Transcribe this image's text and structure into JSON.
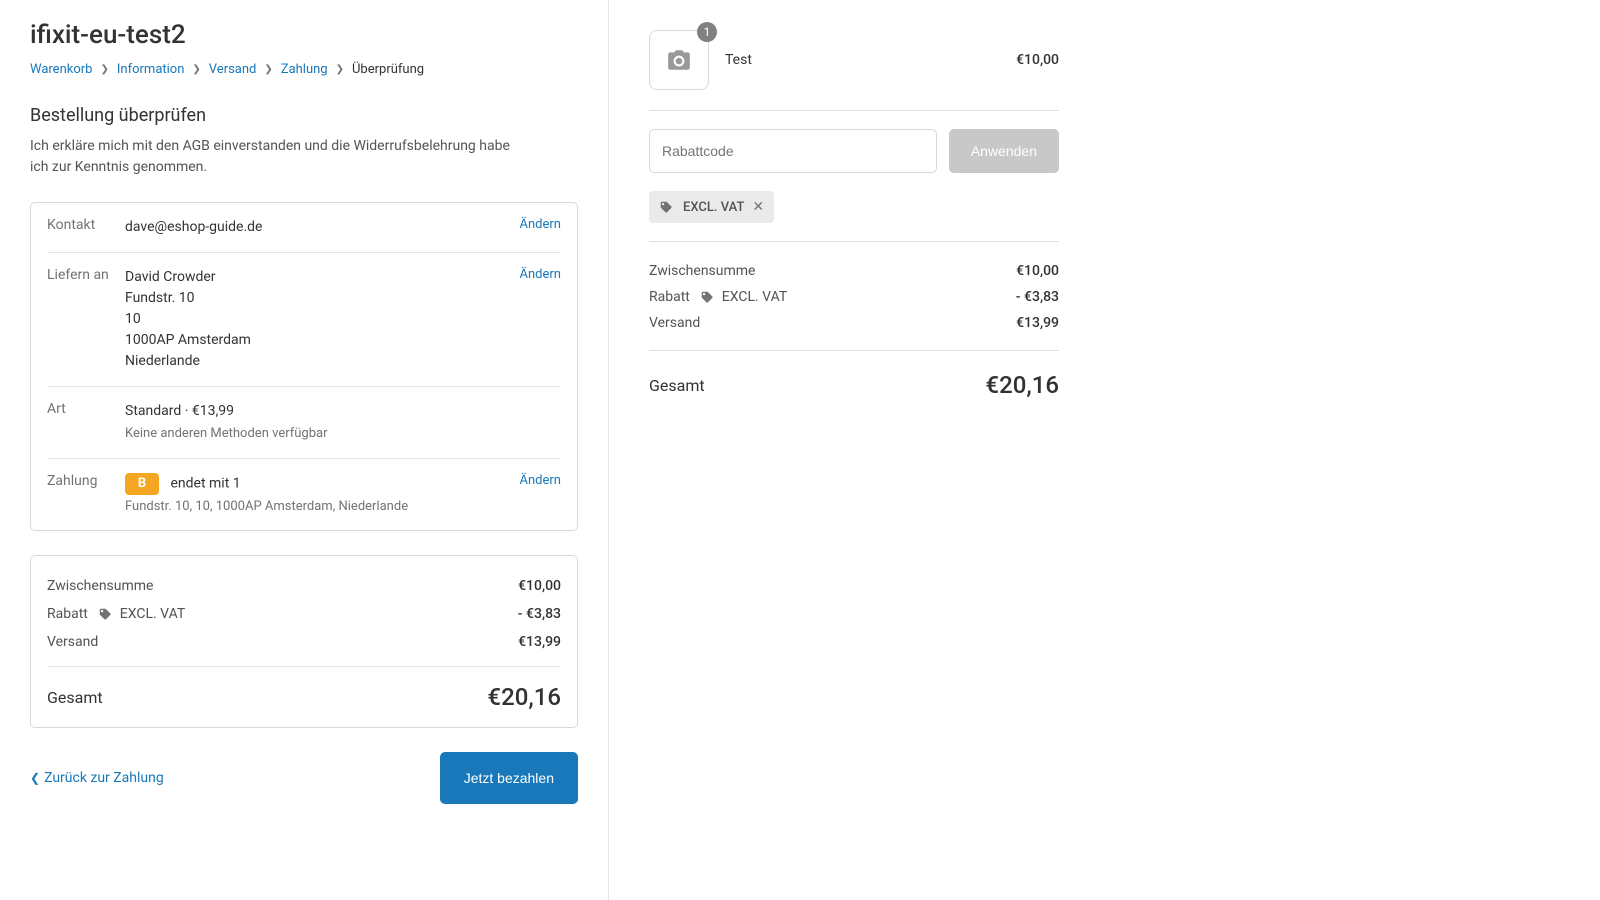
{
  "store": {
    "name": "ifixit-eu-test2"
  },
  "breadcrumb": {
    "cart": "Warenkorb",
    "information": "Information",
    "shipping": "Versand",
    "payment": "Zahlung",
    "review": "Überprüfung"
  },
  "review": {
    "title": "Bestellung überprüfen",
    "subtitle": "Ich erkläre mich mit den AGB einverstanden und die Widerrufsbelehrung habe ich zur Kenntnis genommen.",
    "change_label": "Ändern",
    "rows": {
      "contact": {
        "label": "Kontakt",
        "value": "dave@eshop-guide.de"
      },
      "ship_to": {
        "label": "Liefern an",
        "lines": [
          "David Crowder",
          "Fundstr. 10",
          "10",
          "1000AP Amsterdam",
          "Niederlande"
        ]
      },
      "method": {
        "label": "Art",
        "value": "Standard · €13,99",
        "sub": "Keine anderen Methoden verfügbar"
      },
      "payment": {
        "label": "Zahlung",
        "badge": "B",
        "value": "endet mit 1",
        "sub": "Fundstr. 10, 10, 1000AP Amsterdam, Niederlande"
      }
    }
  },
  "totals": {
    "subtotal_label": "Zwischensumme",
    "subtotal_value": "€10,00",
    "discount_label": "Rabatt",
    "discount_name": "EXCL. VAT",
    "discount_value": "- €3,83",
    "shipping_label": "Versand",
    "shipping_value": "€13,99",
    "grand_label": "Gesamt",
    "grand_value": "€20,16"
  },
  "actions": {
    "back": "Zurück zur Zahlung",
    "pay": "Jetzt bezahlen"
  },
  "cart": {
    "item": {
      "name": "Test",
      "qty": "1",
      "price": "€10,00"
    },
    "discount_placeholder": "Rabattcode",
    "apply": "Anwenden",
    "chip": "EXCL. VAT"
  }
}
